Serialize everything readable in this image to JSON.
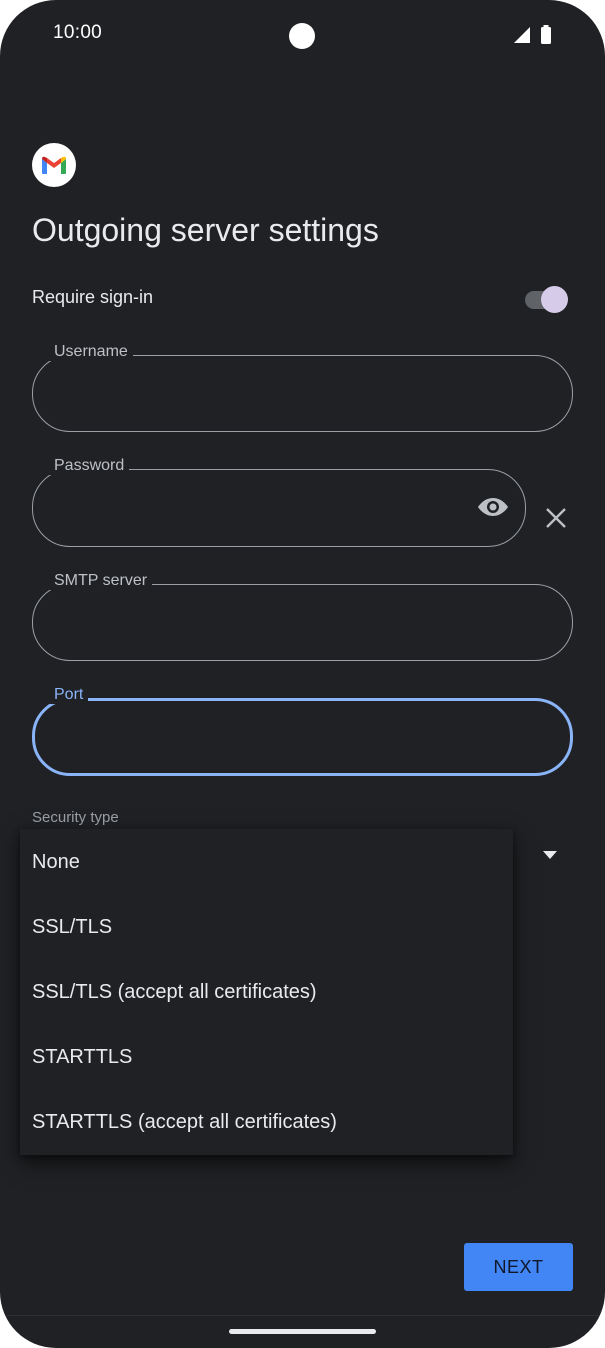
{
  "status_bar": {
    "time": "10:00"
  },
  "header": {
    "logo": "gmail-logo",
    "title": "Outgoing server settings"
  },
  "require_signin": {
    "label": "Require sign-in",
    "enabled": true
  },
  "fields": {
    "username": {
      "label": "Username",
      "value": ""
    },
    "password": {
      "label": "Password",
      "value": ""
    },
    "smtp_server": {
      "label": "SMTP server",
      "value": ""
    },
    "port": {
      "label": "Port",
      "value": "",
      "focused": true
    }
  },
  "security": {
    "label": "Security type",
    "options": [
      "None",
      "SSL/TLS",
      "SSL/TLS (accept all certificates)",
      "STARTTLS",
      "STARTTLS (accept all certificates)"
    ]
  },
  "actions": {
    "next_label": "NEXT"
  },
  "icons": {
    "password_visibility": "eye-icon",
    "clear": "close-icon",
    "dropdown": "triangle-down-icon"
  },
  "colors": {
    "background": "#202124",
    "accent": "#8ab4f8",
    "button": "#4285f4"
  }
}
